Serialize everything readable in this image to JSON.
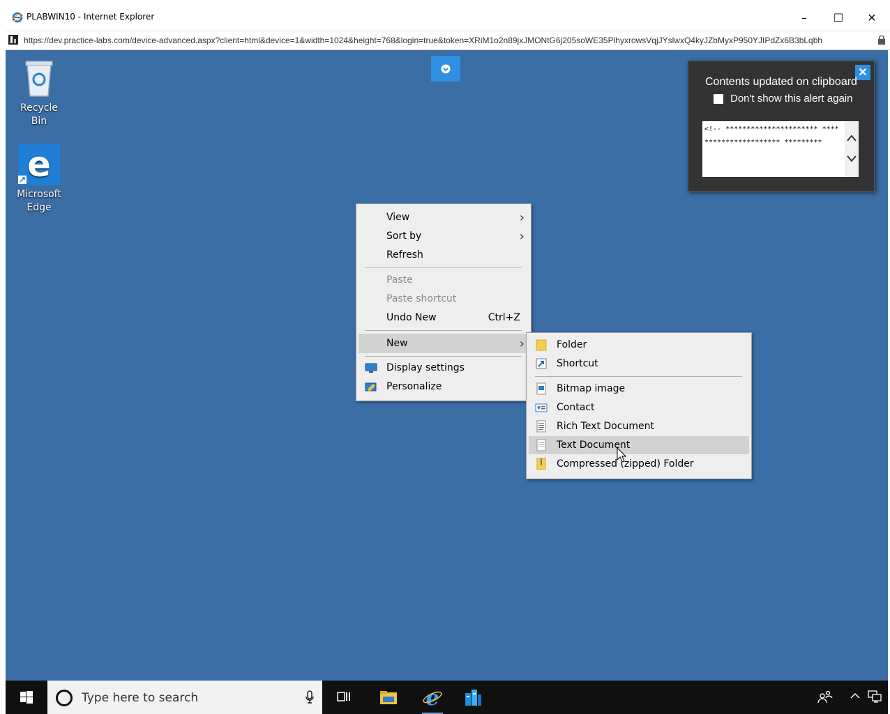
{
  "window": {
    "title": "PLABWIN10 - Internet Explorer",
    "url": "https://dev.practice-labs.com/device-advanced.aspx?client=html&device=1&width=1024&height=768&login=true&token=XRiM1o2n89jxJMONtG6j205soWE35PlhyxrowsVqjJYslwxQ4kyJZbMyxP950YJIPdZx6B3bLqbh",
    "minimize": "–",
    "maximize": "☐",
    "close": "✕"
  },
  "desktop": {
    "icons": [
      {
        "label": "Recycle Bin",
        "icon": "recycle-bin-icon"
      },
      {
        "label_line1": "Microsoft",
        "label_line2": "Edge",
        "icon": "edge-icon"
      }
    ]
  },
  "clipboard_alert": {
    "title": "Contents updated on clipboard",
    "checkbox_label": "Don't show this alert again",
    "content": "<!-- ********************** ********************** *********",
    "close": "✕"
  },
  "context_menu": {
    "items": [
      {
        "label": "View",
        "arrow": "›"
      },
      {
        "label": "Sort by",
        "arrow": "›"
      },
      {
        "label": "Refresh"
      },
      {
        "label": "Paste"
      },
      {
        "label": "Paste shortcut"
      },
      {
        "label": "Undo New",
        "shortcut": "Ctrl+Z"
      },
      {
        "label": "New",
        "arrow": "›"
      },
      {
        "label": "Display settings"
      },
      {
        "label": "Personalize"
      }
    ]
  },
  "new_submenu": {
    "items": [
      {
        "label": "Folder"
      },
      {
        "label": "Shortcut"
      },
      {
        "label": "Bitmap image"
      },
      {
        "label": "Contact"
      },
      {
        "label": "Rich Text Document"
      },
      {
        "label": "Text Document"
      },
      {
        "label": "Compressed (zipped) Folder"
      }
    ]
  },
  "taskbar": {
    "search_placeholder": "Type here to search"
  },
  "colors": {
    "desktop": "#3b6ea5",
    "accent": "#2f8fe0",
    "taskbar": "#101010"
  }
}
